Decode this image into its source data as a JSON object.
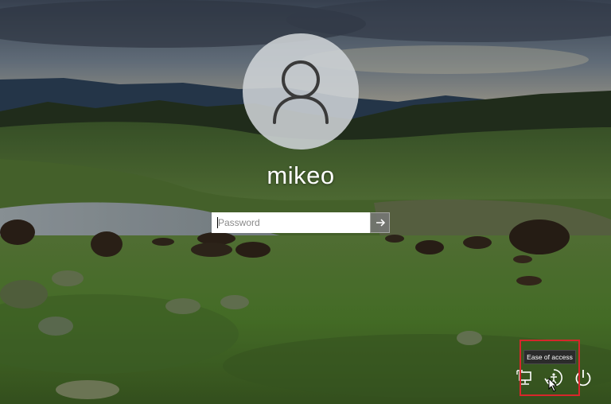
{
  "user": {
    "name": "mikeo"
  },
  "password": {
    "placeholder": "Password"
  },
  "tooltip": {
    "text": "Ease of access"
  },
  "icons": {
    "avatar": "person-icon",
    "submit": "arrow-right-icon",
    "network": "network-icon",
    "ease_of_access": "ease-of-access-icon",
    "power": "power-icon"
  },
  "colors": {
    "highlight": "#d7262b"
  }
}
